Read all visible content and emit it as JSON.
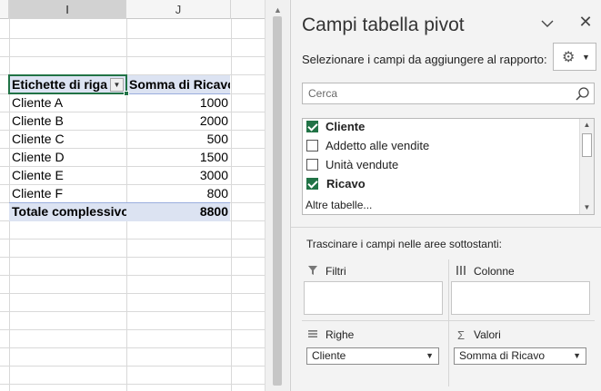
{
  "sheet": {
    "columns": [
      "I",
      "J"
    ],
    "selected_column": "I",
    "pivot": {
      "row_header": "Etichette di riga",
      "value_header": "Somma di  Ricavo",
      "rows": [
        {
          "label": "Cliente A",
          "value": "1000"
        },
        {
          "label": "Cliente B",
          "value": "2000"
        },
        {
          "label": "Cliente C",
          "value": "500"
        },
        {
          "label": "Cliente D",
          "value": "1500"
        },
        {
          "label": "Cliente E",
          "value": "3000"
        },
        {
          "label": "Cliente F",
          "value": "800"
        }
      ],
      "total_label": "Totale complessivo",
      "total_value": "8800"
    }
  },
  "pane": {
    "title": "Campi tabella pivot",
    "choose_fields": "Selezionare i campi da aggiungere al rapporto:",
    "search_placeholder": "Cerca",
    "fields": [
      {
        "label": "Cliente",
        "checked": true
      },
      {
        "label": "Addetto alle vendite",
        "checked": false
      },
      {
        "label": "Unità vendute",
        "checked": false
      },
      {
        "label": "Ricavo",
        "checked": true
      }
    ],
    "more_tables": "Altre tabelle...",
    "drag_text": "Trascinare i campi nelle aree sottostanti:",
    "areas": {
      "filters": {
        "label": "Filtri",
        "icon": "filter-icon"
      },
      "columns": {
        "label": "Colonne",
        "icon": "columns-icon"
      },
      "rows": {
        "label": "Righe",
        "icon": "rows-icon",
        "item": "Cliente"
      },
      "values": {
        "label": "Valori",
        "icon": "sigma-icon",
        "item": "Somma di  Ricavo"
      }
    }
  },
  "colors": {
    "excel_green": "#217346",
    "pivot_header_bg": "#dce3f2"
  }
}
